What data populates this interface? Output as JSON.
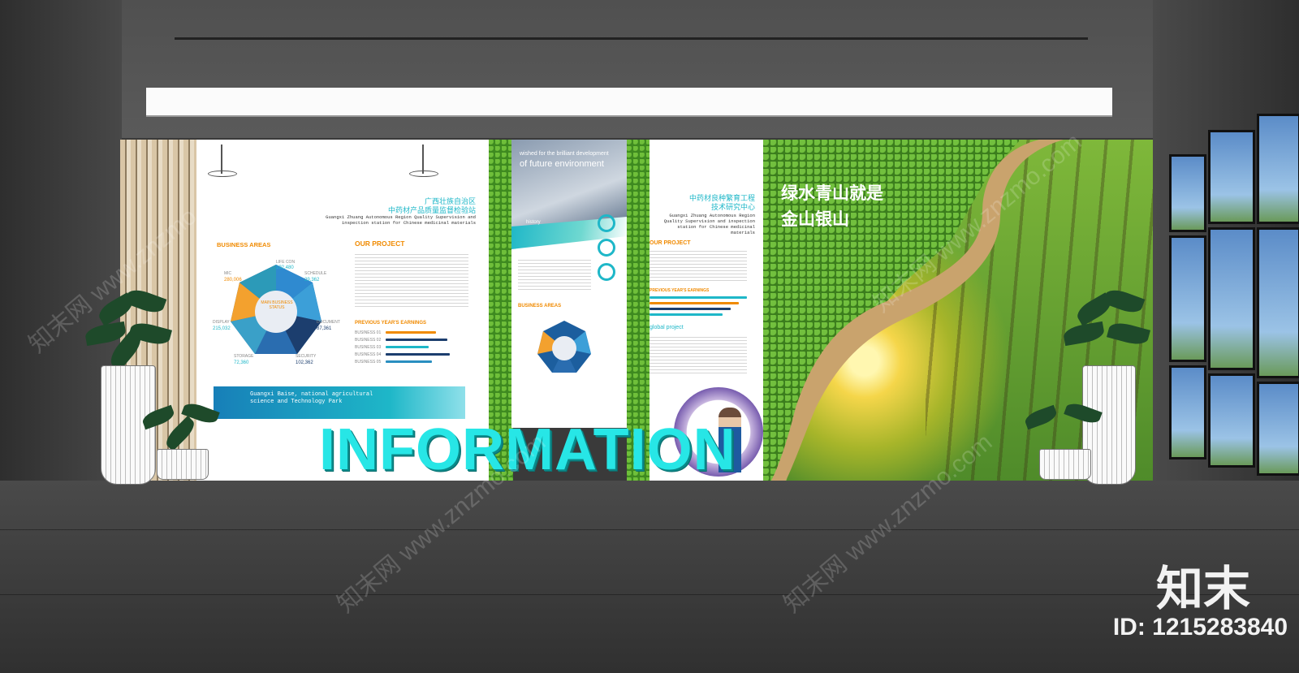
{
  "panel1": {
    "title_cn_1": "广西壮族自治区",
    "title_cn_2": "中药材产品质量监督检验站",
    "title_en": "Guangxi Zhuang Autonomous Region Quality Supervision and inspection station for Chinese medicinal materials",
    "business_areas": "BUSINESS AREAS",
    "our_project": "OUR PROJECT",
    "hub_label": "MAIN BUSINESS STATUS",
    "segments": [
      {
        "label": "LIFE CON",
        "value": "192,480"
      },
      {
        "label": "SCHEDULE",
        "value": "29,362"
      },
      {
        "label": "DOCUMENT",
        "value": "87,361"
      },
      {
        "label": "SECURITY",
        "value": "102,362"
      },
      {
        "label": "STORAGE",
        "value": "72,360"
      },
      {
        "label": "DISPLAY",
        "value": "215,032"
      },
      {
        "label": "MIC",
        "value": "280,006"
      }
    ],
    "earnings_title": "PREVIOUS YEAR'S EARNINGS",
    "earnings": [
      {
        "label": "BUSINESS 01",
        "fraction": 0.56,
        "color": "#f08a00"
      },
      {
        "label": "BUSINESS 02",
        "fraction": 0.69,
        "color": "#1c3e6e"
      },
      {
        "label": "BUSINESS 03",
        "fraction": 0.48,
        "color": "#1eb7c8"
      },
      {
        "label": "BUSINESS 04",
        "fraction": 0.72,
        "color": "#1c3e6e"
      },
      {
        "label": "BUSINESS 05",
        "fraction": 0.52,
        "color": "#2a8fc0"
      }
    ],
    "banner_text": "Guangxi Baise, national agricultural science and Technology Park"
  },
  "panel2": {
    "headline_1": "wished for the brilliant development",
    "headline_2": "of future environment",
    "history": "history",
    "business_areas": "BUSINESS AREAS"
  },
  "panel3": {
    "title_cn_1": "中药材良种繁育工程",
    "title_cn_2": "技术研究中心",
    "title_en": "Guangxi Zhuang Autonomous Region Quality Supervision and inspection station for Chinese medicinal materials",
    "our_project": "OUR PROJECT",
    "earnings_title": "PREVIOUS YEAR'S EARNINGS",
    "global_project": "global project"
  },
  "forest": {
    "slogan_1": "绿水青山就是",
    "slogan_2": "金山银山"
  },
  "sign": {
    "text": "INFORMATION"
  },
  "watermark": {
    "text": "知末网 www.znzmo.com",
    "logo": "知末",
    "id": "ID: 1215283840"
  },
  "colors": {
    "accent_cyan": "#27e6e6",
    "orange": "#f08a00",
    "navy": "#1c3e6e",
    "teal": "#1eb7c8"
  }
}
